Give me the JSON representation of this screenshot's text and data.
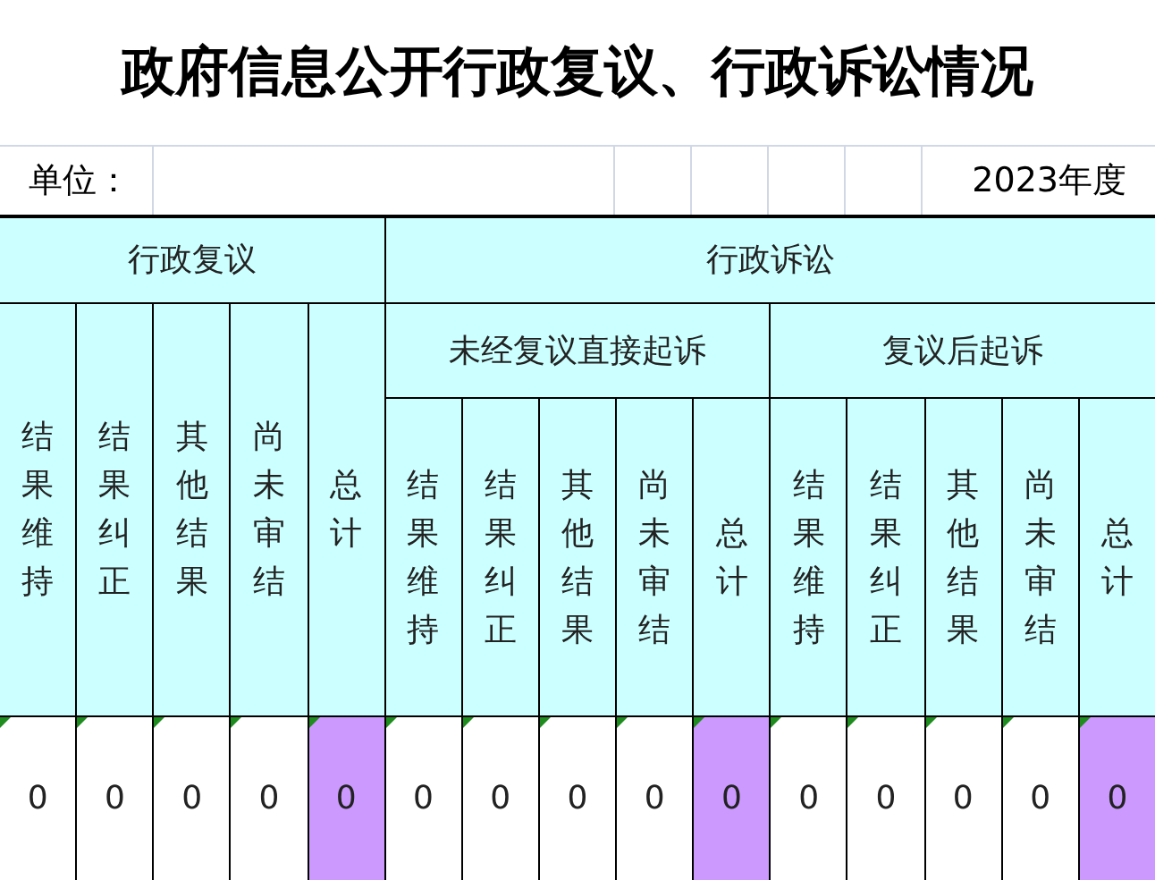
{
  "title": "政府信息公开行政复议、行政诉讼情况",
  "unit_label": "单位：",
  "year": "2023年度",
  "review": {
    "label": "行政复议",
    "columns": [
      {
        "label": "结果维持"
      },
      {
        "label": "结果纠正"
      },
      {
        "label": "其他结果"
      },
      {
        "label": "尚未审结"
      },
      {
        "label": "总计"
      }
    ]
  },
  "litigation": {
    "label": "行政诉讼",
    "subgroups": [
      {
        "label": "未经复议直接起诉",
        "columns": [
          {
            "label": "结果维持"
          },
          {
            "label": "结果纠正"
          },
          {
            "label": "其他结果"
          },
          {
            "label": "尚未审结"
          },
          {
            "label": "总计"
          }
        ]
      },
      {
        "label": "复议后起诉",
        "columns": [
          {
            "label": "结果维持"
          },
          {
            "label": "结果纠正"
          },
          {
            "label": "其他结果"
          },
          {
            "label": "尚未审结"
          },
          {
            "label": "总计"
          }
        ]
      }
    ]
  },
  "values": [
    {
      "value": "0",
      "kind": "item"
    },
    {
      "value": "0",
      "kind": "item"
    },
    {
      "value": "0",
      "kind": "item"
    },
    {
      "value": "0",
      "kind": "item"
    },
    {
      "value": "0",
      "kind": "total"
    },
    {
      "value": "0",
      "kind": "item"
    },
    {
      "value": "0",
      "kind": "item"
    },
    {
      "value": "0",
      "kind": "item"
    },
    {
      "value": "0",
      "kind": "item"
    },
    {
      "value": "0",
      "kind": "total"
    },
    {
      "value": "0",
      "kind": "item"
    },
    {
      "value": "0",
      "kind": "item"
    },
    {
      "value": "0",
      "kind": "item"
    },
    {
      "value": "0",
      "kind": "item"
    },
    {
      "value": "0",
      "kind": "total"
    }
  ]
}
